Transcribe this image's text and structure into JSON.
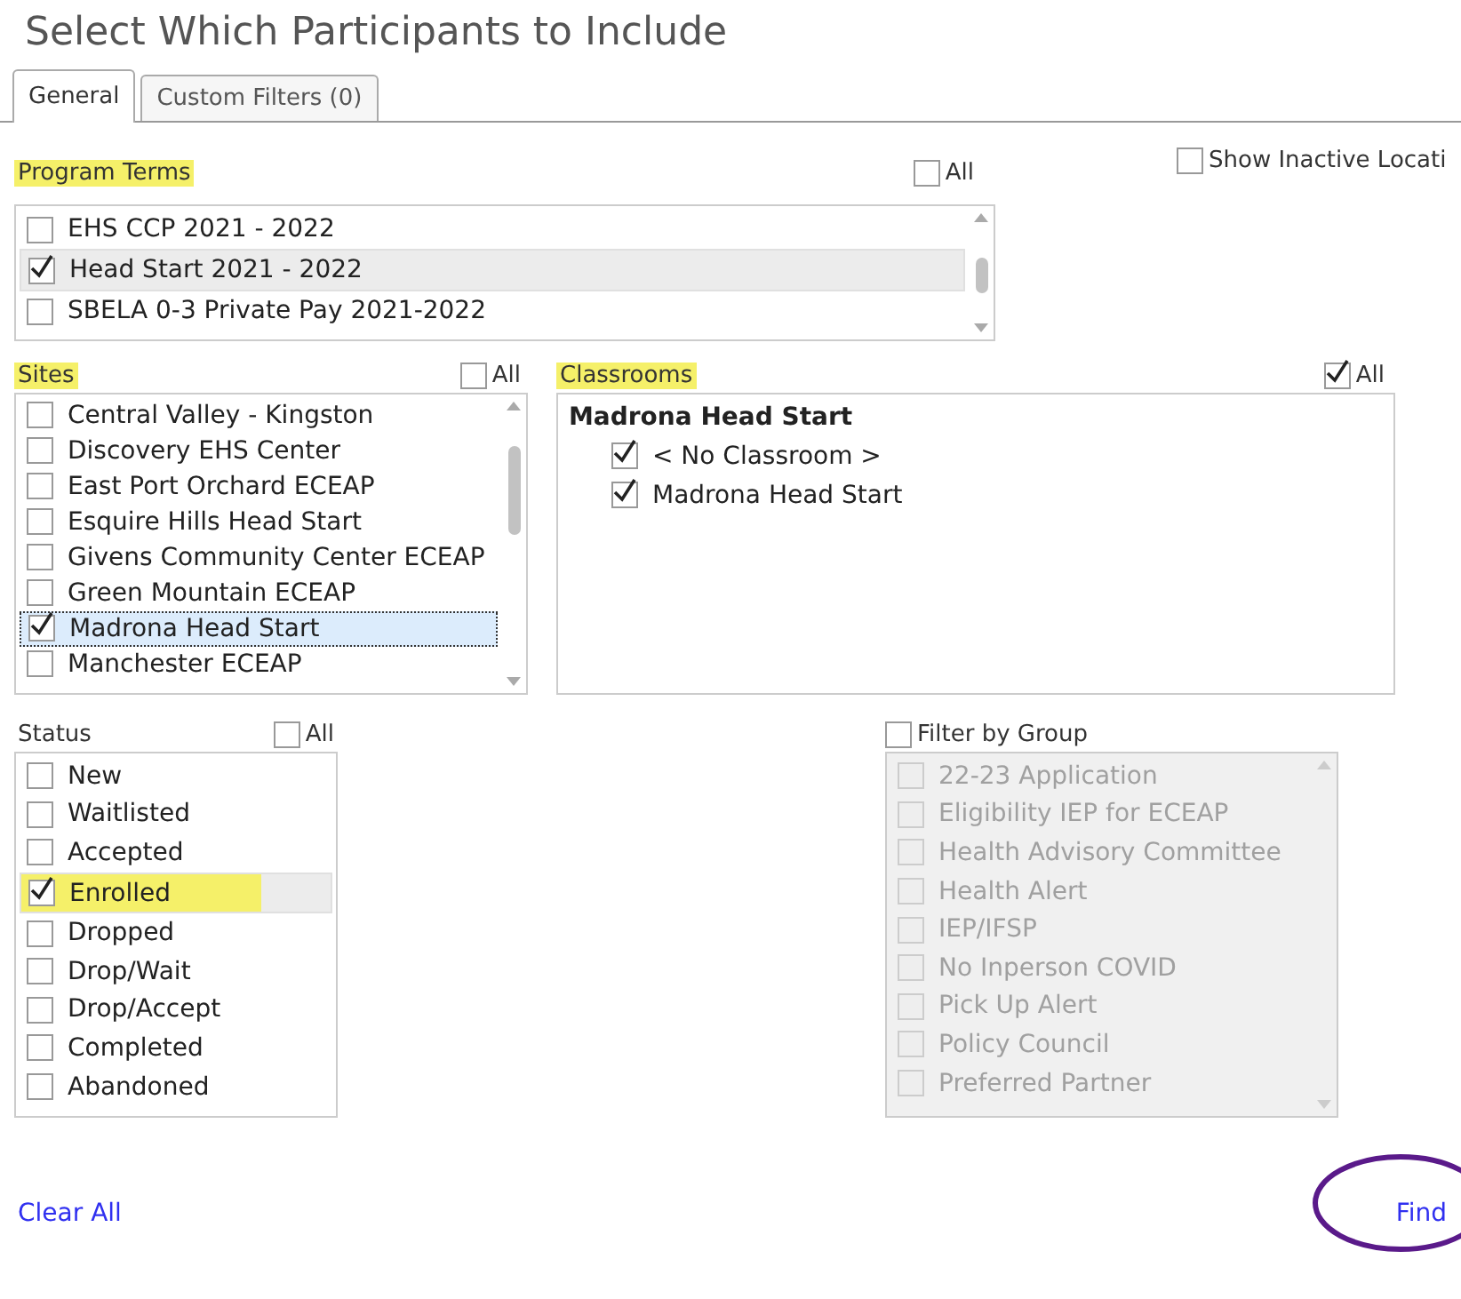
{
  "title": "Select Which Participants to Include",
  "tabs": [
    {
      "label": "General",
      "selected": true
    },
    {
      "label": "Custom Filters (0)",
      "selected": false
    }
  ],
  "show_inactive": {
    "label": "Show Inactive Locati",
    "checked": false
  },
  "program_terms": {
    "label": "Program Terms",
    "highlighted": true,
    "all": {
      "label": "All",
      "checked": false
    },
    "items": [
      {
        "label": "EHS CCP 2021 - 2022",
        "checked": false,
        "selected": false
      },
      {
        "label": "Head Start 2021 - 2022",
        "checked": true,
        "selected": true
      },
      {
        "label": "SBELA 0-3 Private Pay 2021-2022",
        "checked": false,
        "selected": false
      }
    ]
  },
  "sites": {
    "label": "Sites",
    "highlighted": true,
    "all": {
      "label": "All",
      "checked": false
    },
    "items": [
      {
        "label": "Central Valley - Kingston",
        "checked": false,
        "selected": false
      },
      {
        "label": "Discovery EHS Center",
        "checked": false,
        "selected": false
      },
      {
        "label": "East Port Orchard ECEAP",
        "checked": false,
        "selected": false
      },
      {
        "label": "Esquire Hills Head Start",
        "checked": false,
        "selected": false
      },
      {
        "label": "Givens Community Center ECEAP",
        "checked": false,
        "selected": false
      },
      {
        "label": "Green Mountain ECEAP",
        "checked": false,
        "selected": false
      },
      {
        "label": "Madrona Head Start",
        "checked": true,
        "selected": true
      },
      {
        "label": "Manchester ECEAP",
        "checked": false,
        "selected": false
      }
    ]
  },
  "classrooms": {
    "label": "Classrooms",
    "highlighted": true,
    "all": {
      "label": "All",
      "checked": true
    },
    "groups": [
      {
        "label": "Madrona Head Start",
        "children": [
          {
            "label": "< No Classroom >",
            "checked": true
          },
          {
            "label": "Madrona Head Start",
            "checked": true
          }
        ]
      }
    ]
  },
  "status": {
    "label": "Status",
    "all": {
      "label": "All",
      "checked": false
    },
    "items": [
      {
        "label": "New",
        "checked": false,
        "selected": false,
        "highlighted": false
      },
      {
        "label": "Waitlisted",
        "checked": false,
        "selected": false,
        "highlighted": false
      },
      {
        "label": "Accepted",
        "checked": false,
        "selected": false,
        "highlighted": false
      },
      {
        "label": "Enrolled",
        "checked": true,
        "selected": true,
        "highlighted": true
      },
      {
        "label": "Dropped",
        "checked": false,
        "selected": false,
        "highlighted": false
      },
      {
        "label": "Drop/Wait",
        "checked": false,
        "selected": false,
        "highlighted": false
      },
      {
        "label": "Drop/Accept",
        "checked": false,
        "selected": false,
        "highlighted": false
      },
      {
        "label": "Completed",
        "checked": false,
        "selected": false,
        "highlighted": false
      },
      {
        "label": "Abandoned",
        "checked": false,
        "selected": false,
        "highlighted": false
      }
    ]
  },
  "groups": {
    "label": "Filter by Group",
    "checked": false,
    "disabled": true,
    "items": [
      {
        "label": "22-23 Application",
        "checked": false
      },
      {
        "label": "Eligibility IEP for ECEAP",
        "checked": false
      },
      {
        "label": "Health Advisory Committee",
        "checked": false
      },
      {
        "label": "Health Alert",
        "checked": false
      },
      {
        "label": "IEP/IFSP",
        "checked": false
      },
      {
        "label": "No Inperson COVID",
        "checked": false
      },
      {
        "label": "Pick Up Alert",
        "checked": false
      },
      {
        "label": "Policy Council",
        "checked": false
      },
      {
        "label": "Preferred Partner",
        "checked": false
      }
    ]
  },
  "footer": {
    "clear": "Clear All",
    "find": "Find",
    "find_circled": true
  }
}
